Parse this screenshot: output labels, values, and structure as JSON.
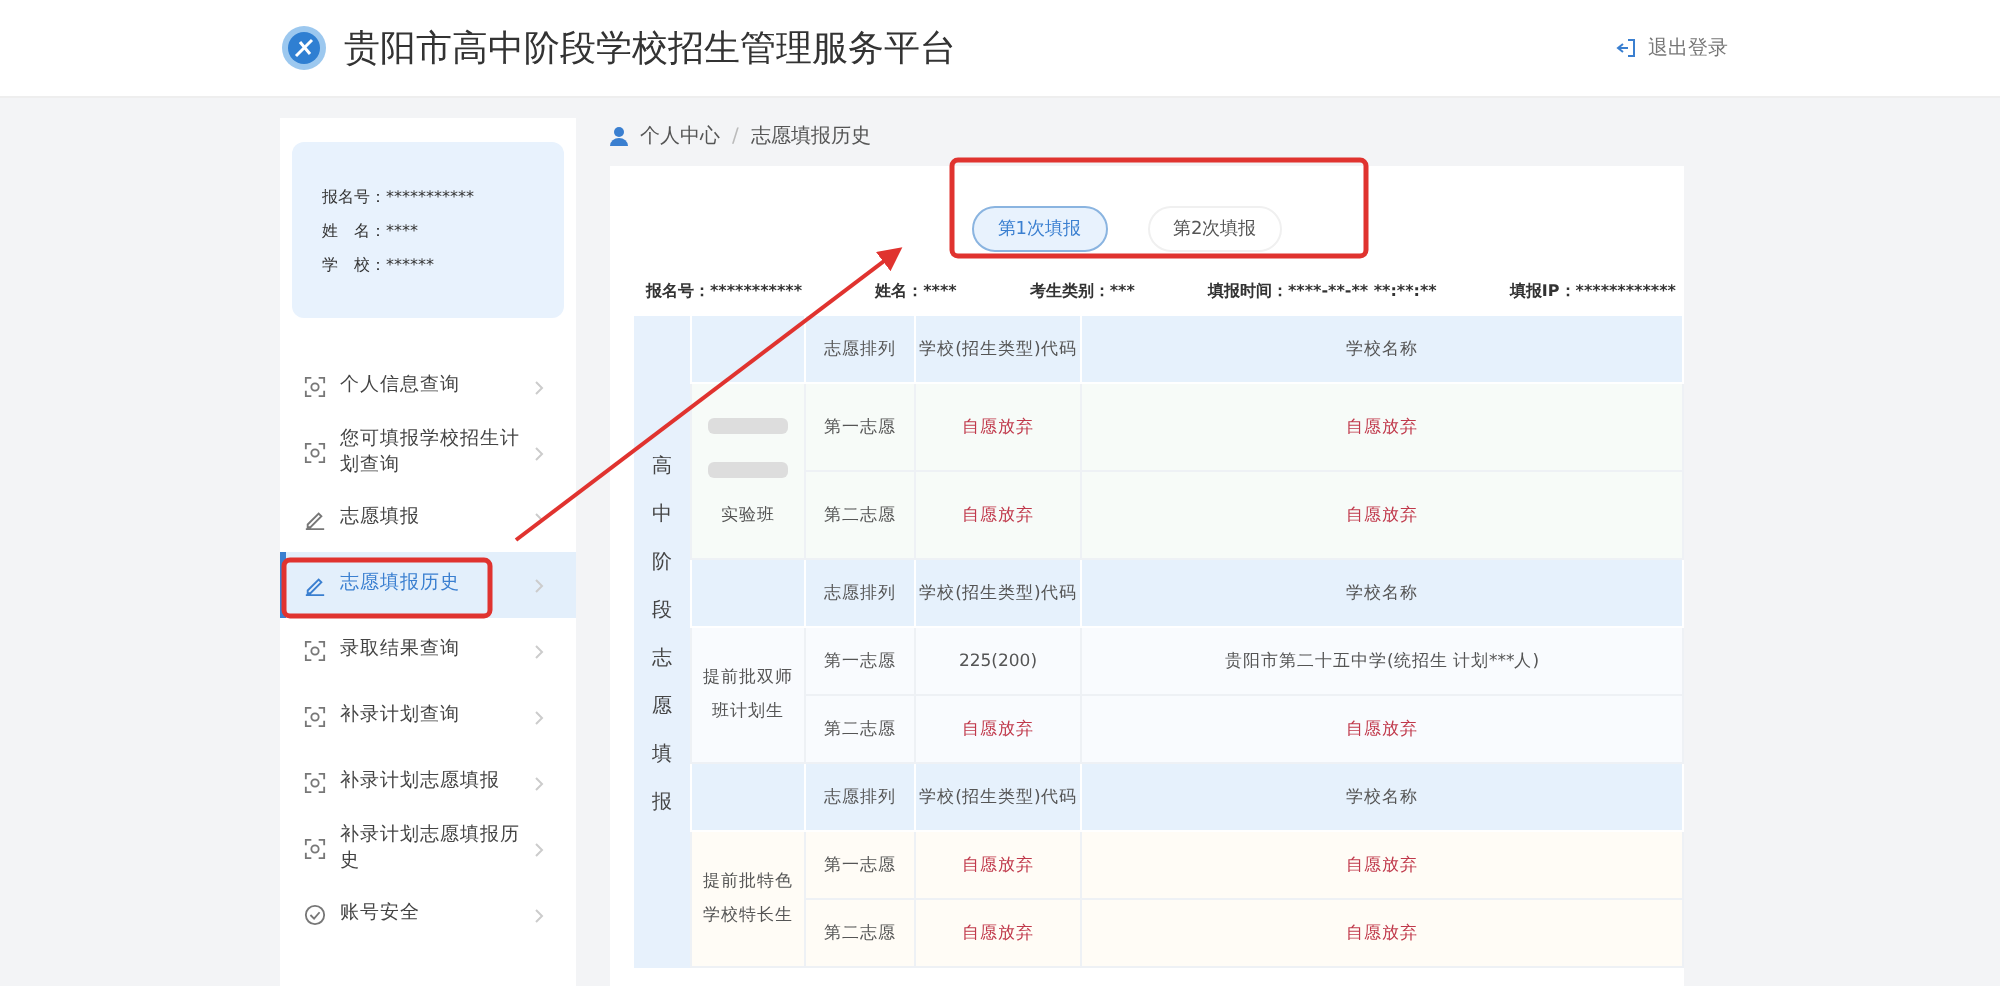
{
  "header": {
    "title": "贵阳市高中阶段学校招生管理服务平台",
    "logout": "退出登录"
  },
  "profile": [
    {
      "label": "报名号：",
      "value": "***********"
    },
    {
      "label": "姓　名：",
      "value": "****"
    },
    {
      "label": "学　校：",
      "value": "******"
    }
  ],
  "menu": [
    {
      "label": "个人信息查询",
      "selected": false
    },
    {
      "label": "您可填报学校招生计划查询",
      "selected": false
    },
    {
      "label": "志愿填报",
      "selected": false
    },
    {
      "label": "志愿填报历史",
      "selected": true
    },
    {
      "label": "录取结果查询",
      "selected": false
    },
    {
      "label": "补录计划查询",
      "selected": false
    },
    {
      "label": "补录计划志愿填报",
      "selected": false
    },
    {
      "label": "补录计划志愿填报历史",
      "selected": false
    },
    {
      "label": "账号安全",
      "selected": false
    }
  ],
  "breadcrumb": {
    "items": [
      "个人中心",
      "志愿填报历史"
    ],
    "separator": "/"
  },
  "tabs": [
    {
      "label": "第1次填报",
      "selected": true
    },
    {
      "label": "第2次填报",
      "selected": false
    }
  ],
  "info": [
    {
      "label": "报名号：",
      "value": "***********"
    },
    {
      "label": "姓名：",
      "value": "****"
    },
    {
      "label": "考生类别：",
      "value": "***"
    },
    {
      "label": "填报时间：",
      "value": "****-**-** **:**:**"
    },
    {
      "label": "填报IP：",
      "value": "************"
    }
  ],
  "table": {
    "section": "高中阶段志愿填报",
    "groups": [
      {
        "name": "实验班",
        "redacted": true,
        "color": "#f7fbf8",
        "columns": [
          "志愿排列",
          "学校(招生类型)代码",
          "学校名称"
        ],
        "rows": [
          {
            "rank": "第一志愿",
            "code": "自愿放弃",
            "school": "自愿放弃",
            "waived": true
          },
          {
            "rank": "第二志愿",
            "code": "自愿放弃",
            "school": "自愿放弃",
            "waived": true
          }
        ]
      },
      {
        "name": "提前批双师班计划生",
        "redacted": false,
        "color": "#f9fbfe",
        "columns": [
          "志愿排列",
          "学校(招生类型)代码",
          "学校名称"
        ],
        "rows": [
          {
            "rank": "第一志愿",
            "code": "225(200)",
            "school": "贵阳市第二十五中学(统招生 计划***人)",
            "waived": false
          },
          {
            "rank": "第二志愿",
            "code": "自愿放弃",
            "school": "自愿放弃",
            "waived": true
          }
        ]
      },
      {
        "name": "提前批特色学校特长生",
        "redacted": false,
        "color": "#fffcf6",
        "columns": [
          "志愿排列",
          "学校(招生类型)代码",
          "学校名称"
        ],
        "rows": [
          {
            "rank": "第一志愿",
            "code": "自愿放弃",
            "school": "自愿放弃",
            "waived": true
          },
          {
            "rank": "第二志愿",
            "code": "自愿放弃",
            "school": "自愿放弃",
            "waived": true
          }
        ]
      }
    ]
  }
}
